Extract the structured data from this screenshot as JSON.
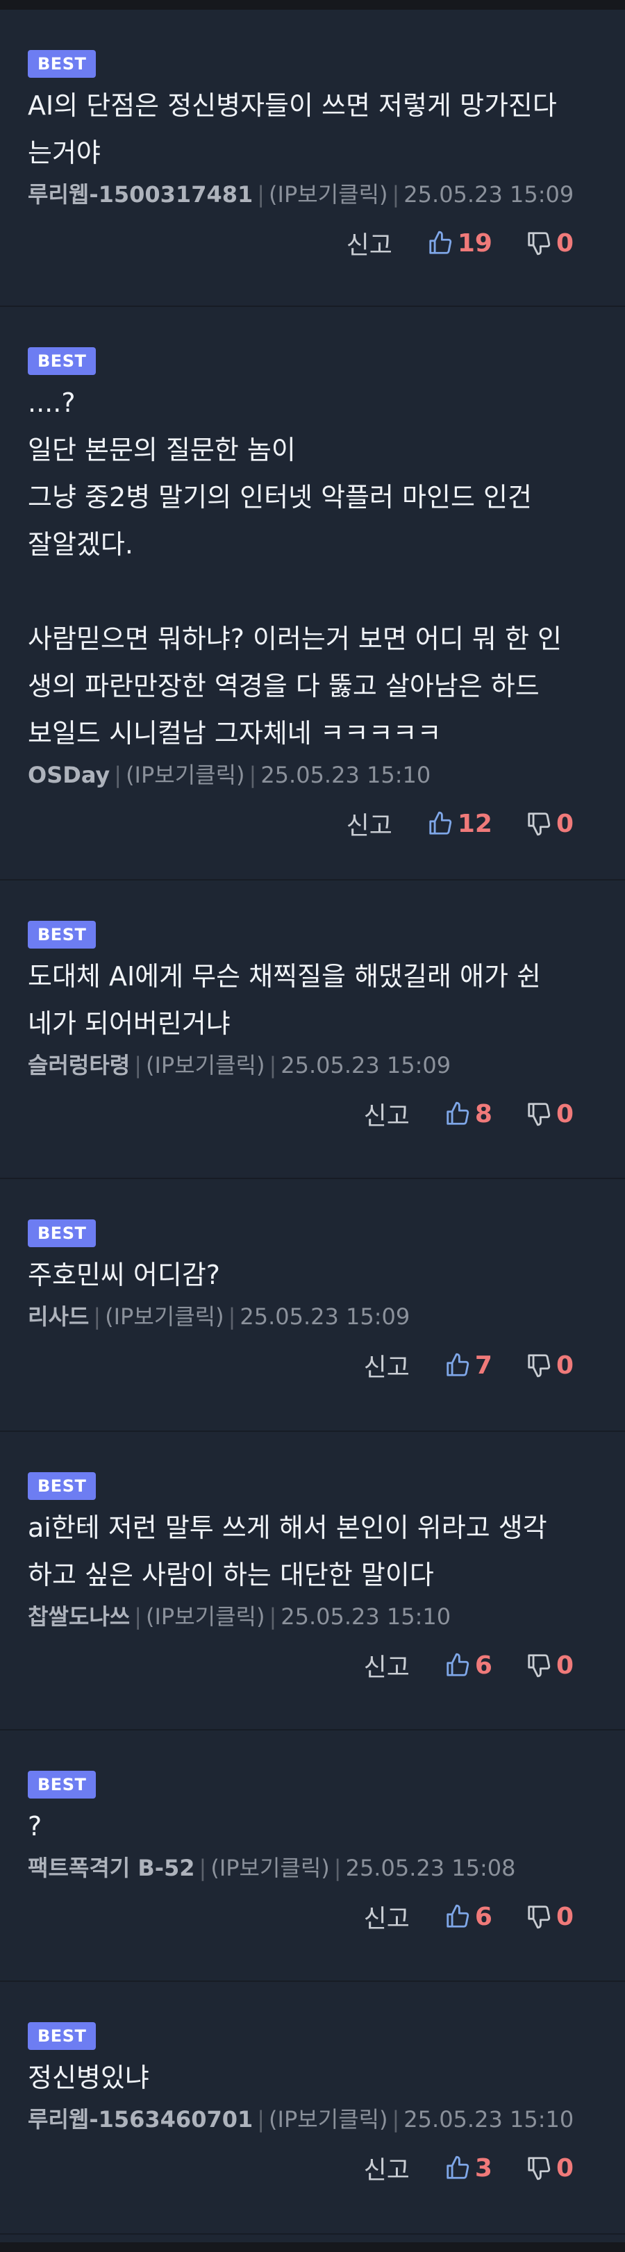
{
  "badge_label": "BEST",
  "report_label": "신고",
  "ip_label": "(IP보기클릭)",
  "colors": {
    "badge": "#6d7df2",
    "count": "#f07a7a",
    "background": "#1e2633"
  },
  "comments": [
    {
      "text": "AI의 단점은 정신병자들이 쓰면 저렇게 망가진다\n는거야",
      "author": "루리웹-1500317481",
      "time": "25.05.23 15:09",
      "likes": "19",
      "dislikes": "0"
    },
    {
      "text": "....?\n일단 본문의 질문한 놈이\n그냥 중2병 말기의 인터넷 악플러 마인드 인건\n잘알겠다.\n\n사람믿으면 뭐하냐? 이러는거 보면 어디 뭐 한 인\n생의 파란만장한 역경을 다 뚫고 살아남은 하드\n보일드 시니컬남 그자체네 ㅋㅋㅋㅋㅋ",
      "author": "OSDay",
      "time": "25.05.23 15:10",
      "likes": "12",
      "dislikes": "0"
    },
    {
      "text": "도대체 AI에게 무슨 채찍질을 해댔길래 애가 쉰\n네가 되어버린거냐",
      "author": "슬러렁타령",
      "time": "25.05.23 15:09",
      "likes": "8",
      "dislikes": "0"
    },
    {
      "text": "주호민씨 어디감?",
      "author": "리사드",
      "time": "25.05.23 15:09",
      "likes": "7",
      "dislikes": "0"
    },
    {
      "text": "ai한테 저런 말투 쓰게 해서 본인이 위라고 생각\n하고 싶은 사람이 하는 대단한 말이다",
      "author": "찹쌀도나쓰",
      "time": "25.05.23 15:10",
      "likes": "6",
      "dislikes": "0"
    },
    {
      "text": "?",
      "author": "팩트폭격기 B-52",
      "time": "25.05.23 15:08",
      "likes": "6",
      "dislikes": "0"
    },
    {
      "text": "정신병있냐",
      "author": "루리웹-1563460701",
      "time": "25.05.23 15:10",
      "likes": "3",
      "dislikes": "0"
    }
  ]
}
